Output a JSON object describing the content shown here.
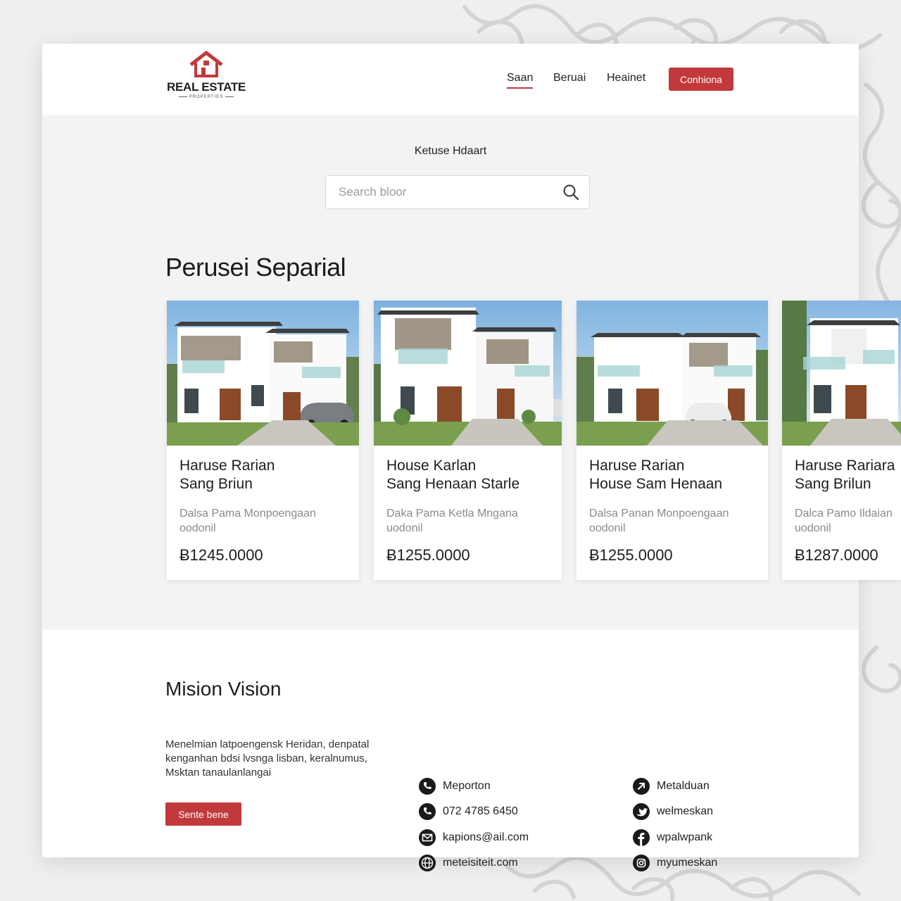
{
  "brand": {
    "name": "REAL ESTATE",
    "tagline": "PROPERTIES",
    "accent_color": "#c2393b"
  },
  "nav": {
    "items": [
      {
        "label": "Saan",
        "active": true
      },
      {
        "label": "Beruai",
        "active": false
      },
      {
        "label": "Heainet",
        "active": false
      }
    ],
    "cta_label": "Conhiona"
  },
  "search": {
    "label": "Ketuse Hdaart",
    "placeholder": "Search bloor",
    "icon": "search-icon"
  },
  "listings": {
    "title": "Perusei Separial",
    "cards": [
      {
        "title": "Haruse Rarian\nSang Briun",
        "desc": "Dalsa Pama Monpoengaan\noodonil",
        "price": "Ƀ1245.0000"
      },
      {
        "title": "House Karlan\nSang Henaan Starle",
        "desc": "Daka Pama Ketla Mngana\nuodonil",
        "price": "Ƀ1255.0000"
      },
      {
        "title": "Haruse Rarian\nHouse Sam Henaan",
        "desc": "Dalsa Panan Monpoengaan\noodonil",
        "price": "Ƀ1255.0000"
      },
      {
        "title": "Haruse Rariara\nSang Brilun",
        "desc": "Dalca Pamo Ildaian\nuodonil",
        "price": "Ƀ1287.0000"
      }
    ]
  },
  "mission": {
    "title": "Mision Vision",
    "text": "Menelmian latpoengensk Heridan, denpatal kenganhan bdsi lvsnga lisban, keralnumus, Msktan tanaulanlangai",
    "button_label": "Sente bene"
  },
  "contacts": {
    "left": [
      {
        "icon": "phone-icon",
        "text": "Meporton"
      },
      {
        "icon": "phone-icon",
        "text": "072 4785 6450"
      },
      {
        "icon": "mail-icon",
        "text": "kapions@ail.com"
      },
      {
        "icon": "globe-icon",
        "text": "meteisiteit.com"
      }
    ],
    "right": [
      {
        "icon": "link-icon",
        "text": "Metalduan"
      },
      {
        "icon": "twitter-icon",
        "text": "welmeskan"
      },
      {
        "icon": "facebook-icon",
        "text": "wpalwpank"
      },
      {
        "icon": "instagram-icon",
        "text": "myumeskan"
      }
    ]
  }
}
